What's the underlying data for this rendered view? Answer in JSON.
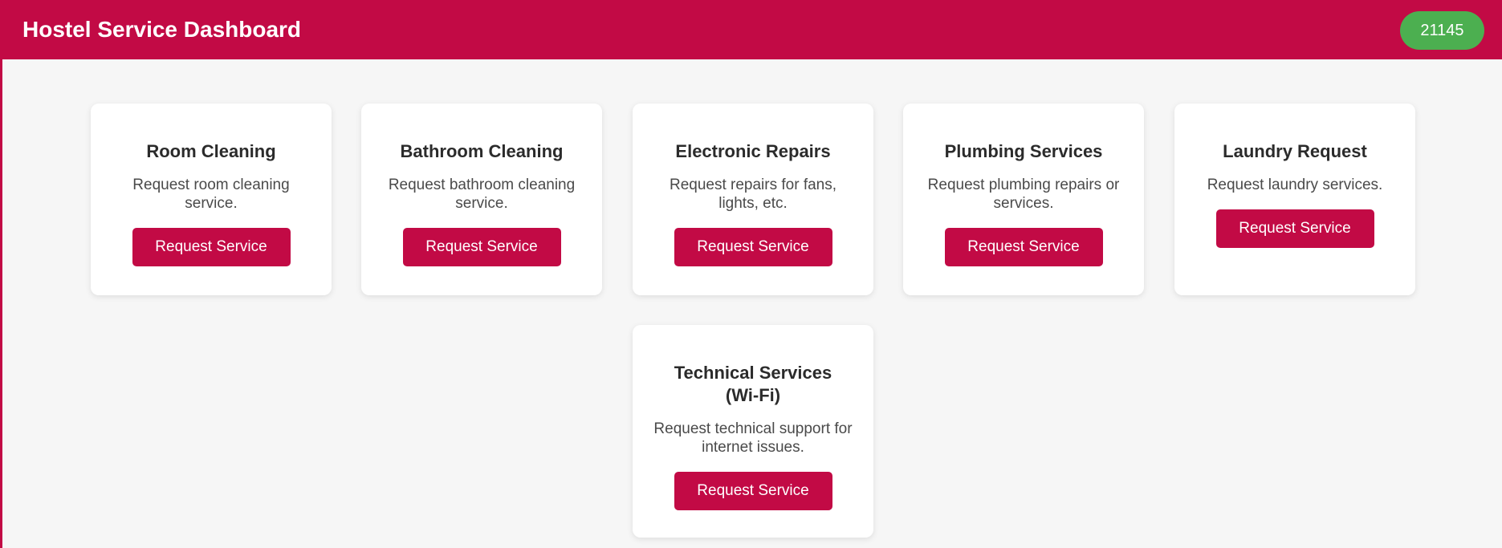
{
  "header": {
    "title": "Hostel Service Dashboard",
    "user_id": "21145"
  },
  "colors": {
    "brand": "#c20a45",
    "badge": "#4caf50",
    "background": "#f6f6f6",
    "card": "#ffffff"
  },
  "services": [
    {
      "title": "Room Cleaning",
      "description": "Request room cleaning service.",
      "button_label": "Request Service"
    },
    {
      "title": "Bathroom Cleaning",
      "description": "Request bathroom cleaning service.",
      "button_label": "Request Service"
    },
    {
      "title": "Electronic Repairs",
      "description": "Request repairs for fans, lights, etc.",
      "button_label": "Request Service"
    },
    {
      "title": "Plumbing Services",
      "description": "Request plumbing repairs or services.",
      "button_label": "Request Service"
    },
    {
      "title": "Laundry Request",
      "description": "Request laundry services.",
      "button_label": "Request Service"
    },
    {
      "title": "Technical Services (Wi-Fi)",
      "description": "Request technical support for internet issues.",
      "button_label": "Request Service"
    }
  ]
}
